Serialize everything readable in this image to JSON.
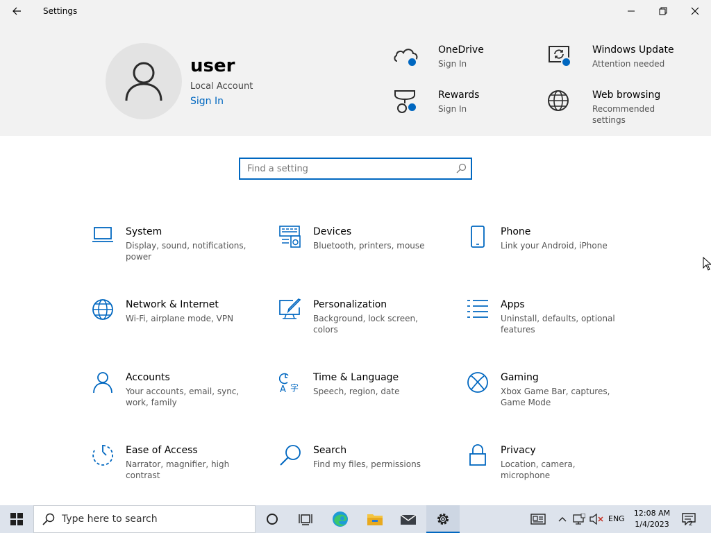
{
  "window": {
    "title": "Settings"
  },
  "header": {
    "user": {
      "name": "user",
      "account_type": "Local Account",
      "sign_in_link": "Sign In"
    },
    "items": [
      {
        "title": "OneDrive",
        "subtitle": "Sign In",
        "icon": "onedrive-cloud-icon"
      },
      {
        "title": "Windows Update",
        "subtitle": "Attention needed",
        "icon": "windows-update-icon"
      },
      {
        "title": "Rewards",
        "subtitle": "Sign In",
        "icon": "rewards-trophy-icon"
      },
      {
        "title": "Web browsing",
        "subtitle": "Recommended settings",
        "icon": "globe-icon"
      }
    ]
  },
  "search": {
    "placeholder": "Find a setting"
  },
  "categories": [
    {
      "title": "System",
      "desc": "Display, sound, notifications, power",
      "icon": "laptop-icon"
    },
    {
      "title": "Devices",
      "desc": "Bluetooth, printers, mouse",
      "icon": "devices-icon"
    },
    {
      "title": "Phone",
      "desc": "Link your Android, iPhone",
      "icon": "phone-icon"
    },
    {
      "title": "Network & Internet",
      "desc": "Wi-Fi, airplane mode, VPN",
      "icon": "globe-icon"
    },
    {
      "title": "Personalization",
      "desc": "Background, lock screen, colors",
      "icon": "personalization-icon"
    },
    {
      "title": "Apps",
      "desc": "Uninstall, defaults, optional features",
      "icon": "apps-list-icon"
    },
    {
      "title": "Accounts",
      "desc": "Your accounts, email, sync, work, family",
      "icon": "person-icon"
    },
    {
      "title": "Time & Language",
      "desc": "Speech, region, date",
      "icon": "time-language-icon"
    },
    {
      "title": "Gaming",
      "desc": "Xbox Game Bar, captures, Game Mode",
      "icon": "xbox-icon"
    },
    {
      "title": "Ease of Access",
      "desc": "Narrator, magnifier, high contrast",
      "icon": "ease-of-access-icon"
    },
    {
      "title": "Search",
      "desc": "Find my files, permissions",
      "icon": "search-icon"
    },
    {
      "title": "Privacy",
      "desc": "Location, camera, microphone",
      "icon": "lock-icon"
    }
  ],
  "taskbar": {
    "search_placeholder": "Type here to search",
    "language": "ENG",
    "time": "12:08 AM",
    "date": "1/4/2023",
    "notification_count": "2"
  },
  "colors": {
    "accent": "#0067c0",
    "header_bg": "#f2f2f2",
    "taskbar_bg": "#dde3ec"
  }
}
